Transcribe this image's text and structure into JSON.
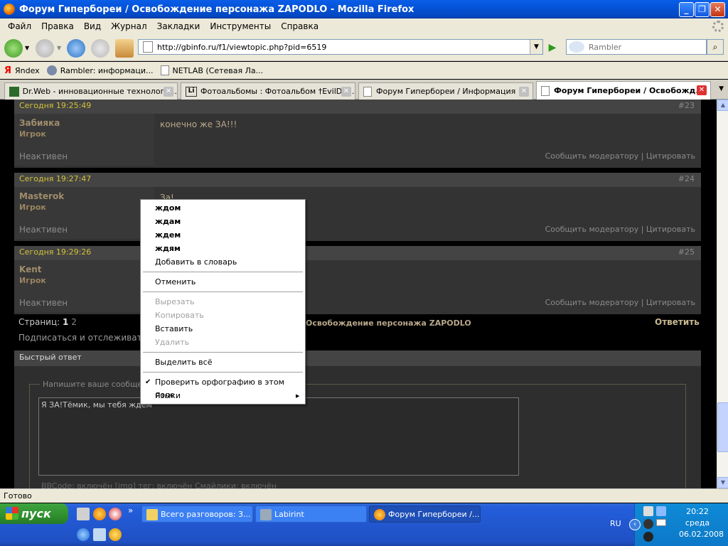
{
  "window": {
    "title": "Форум Гипербореи / Освобождение персонажа ZAPODLO - Mozilla Firefox",
    "buttons": {
      "min": "_",
      "max": "❐",
      "close": "✕"
    }
  },
  "menu": [
    "Файл",
    "Правка",
    "Вид",
    "Журнал",
    "Закладки",
    "Инструменты",
    "Справка"
  ],
  "nav": {
    "url": "http://gbinfo.ru/f1/viewtopic.php?pid=6519",
    "search_placeholder": "Rambler"
  },
  "bookmarks": [
    {
      "label": "Яndex"
    },
    {
      "label": "Rambler: информаци..."
    },
    {
      "label": "NETLAB (Сетевая Ла..."
    }
  ],
  "tabs": [
    {
      "label": "Dr.Web - инновационные технологи..."
    },
    {
      "label": "Фотоальбомы : Фотоальбом †EvilDe..."
    },
    {
      "label": "Форум Гипербореи / Информация"
    },
    {
      "label": "Форум Гипербореи / Освобожд..."
    }
  ],
  "posts": [
    {
      "time": "Сегодня 19:25:49",
      "num": "#23",
      "author": "Забияка",
      "role": "Игрок",
      "text": "конечно же ЗА!!!",
      "status": "Неактивен",
      "report": "Сообщить модератору",
      "sep": "|",
      "quote": "Цитировать"
    },
    {
      "time": "Сегодня 19:27:47",
      "num": "#24",
      "author": "Masterok",
      "role": "Игрок",
      "text": "За!",
      "status": "Неактивен",
      "report": "Сообщить модератору",
      "sep": "|",
      "quote": "Цитировать"
    },
    {
      "time": "Сегодня 19:29:26",
      "num": "#25",
      "author": "Kent",
      "role": "Игрок",
      "text": "",
      "status": "Неактивен",
      "report": "Сообщить модератору",
      "sep": "|",
      "quote": "Цитировать"
    }
  ],
  "pager": {
    "label": "Страниц:",
    "current": "1",
    "next": "2"
  },
  "breadcrumb": "Освобождение персонажа ZAPODLO",
  "reply": "Ответить",
  "subscribe": "Подписаться и отслеживат",
  "quick": {
    "title": "Быстрый ответ",
    "legend": "Напишите ваше сообще",
    "text": "Я ЗА!Тёмик, мы тебя ждём",
    "info": "BBCode: включён     [img] тег: включён     Смайлики: включён"
  },
  "context_menu": {
    "suggestions": [
      "ждом",
      "ждам",
      "ждем",
      "ждям"
    ],
    "add_dict": "Добавить в словарь",
    "undo": "Отменить",
    "cut": "Вырезать",
    "copy": "Копировать",
    "paste": "Вставить",
    "delete": "Удалить",
    "select_all": "Выделить всё",
    "spellcheck": "Проверить орфографию в этом поле",
    "languages": "Языки",
    "check_mark": "✔",
    "submenu_arrow": "▶"
  },
  "status": "Готово",
  "taskbar": {
    "start": "пуск",
    "chevron": "»",
    "tasks": [
      "Всего разговоров: 3...",
      "Labirint",
      "Форум Гипербореи /..."
    ],
    "lang": "RU",
    "time": "20:22",
    "day": "среда",
    "date": "06.02.2008"
  },
  "colors": {
    "accent": "#0553d8",
    "post_time": "#d4c23a",
    "author": "#a08d6b"
  }
}
